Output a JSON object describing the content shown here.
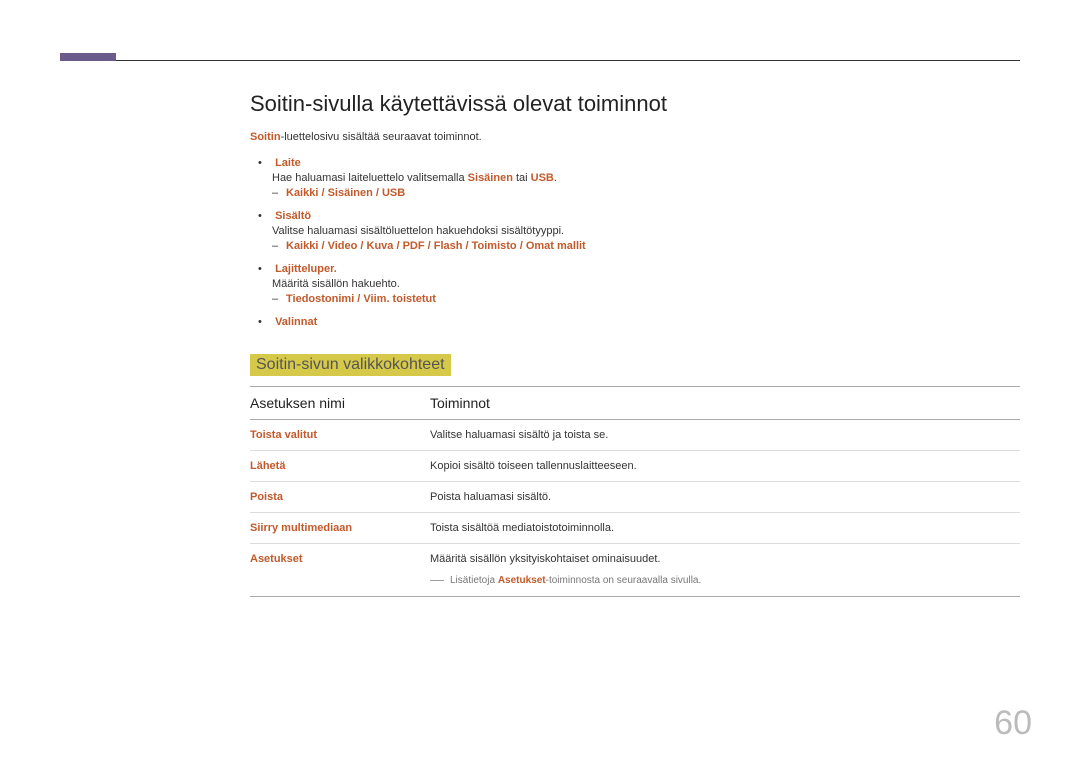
{
  "header": {
    "title": "Soitin-sivulla käytettävissä olevat toiminnot",
    "intro_prefix": "Soitin",
    "intro_rest": "-luettelosivu sisältää seuraavat toiminnot."
  },
  "items": [
    {
      "label": "Laite",
      "desc_pre": "Hae haluamasi laiteluettelo valitsemalla ",
      "desc_bold1": "Sisäinen",
      "desc_mid": " tai ",
      "desc_bold2": "USB",
      "desc_post": ".",
      "sub_chain": "Kaikki / Sisäinen / USB"
    },
    {
      "label": "Sisältö",
      "desc_plain": "Valitse haluamasi sisältöluettelon hakuehdoksi sisältötyyppi.",
      "sub_chain": "Kaikki / Video / Kuva / PDF / Flash / Toimisto / Omat mallit"
    },
    {
      "label": "Lajitteluper.",
      "desc_plain": "Määritä sisällön hakuehto.",
      "sub_chain": "Tiedostonimi / Viim. toistetut"
    },
    {
      "label": "Valinnat"
    }
  ],
  "section2": {
    "title": "Soitin-sivun valikkokohteet",
    "col_name": "Asetuksen nimi",
    "col_func": "Toiminnot",
    "rows": [
      {
        "name": "Toista valitut",
        "func": "Valitse haluamasi sisältö ja toista se."
      },
      {
        "name": "Lähetä",
        "func": "Kopioi sisältö toiseen tallennuslaitteeseen."
      },
      {
        "name": "Poista",
        "func": "Poista haluamasi sisältö."
      },
      {
        "name": "Siirry multimediaan",
        "func": "Toista sisältöä mediatoistotoiminnolla."
      },
      {
        "name": "Asetukset",
        "func": "Määritä sisällön yksityiskohtaiset ominaisuudet.",
        "note_pre": "Lisätietoja ",
        "note_bold": "Asetukset",
        "note_post": "-toiminnosta on seuraavalla sivulla."
      }
    ]
  },
  "pagenum": "60"
}
